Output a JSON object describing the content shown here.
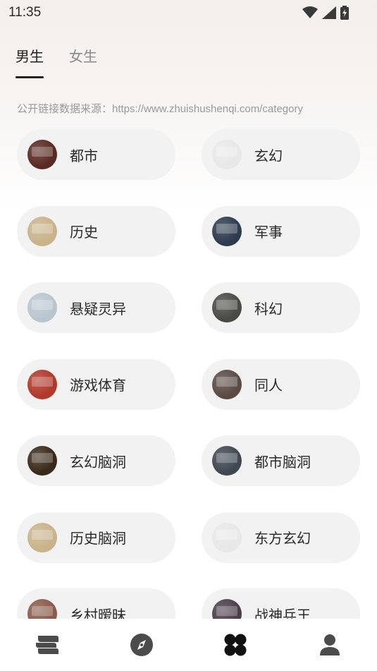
{
  "status_bar": {
    "time": "11:35"
  },
  "tabs": [
    {
      "label": "男生",
      "active": true
    },
    {
      "label": "女生",
      "active": false
    }
  ],
  "source_note": "公开链接数据来源：https://www.zhuishushenqi.com/category",
  "categories": [
    {
      "label": "都市",
      "thumb_color": "#5a2a22"
    },
    {
      "label": "玄幻",
      "thumb_color": "#e8e8e8"
    },
    {
      "label": "历史",
      "thumb_color": "#c9b38a"
    },
    {
      "label": "军事",
      "thumb_color": "#2e3a4e"
    },
    {
      "label": "悬疑灵异",
      "thumb_color": "#b9c6d0"
    },
    {
      "label": "科幻",
      "thumb_color": "#4a4a44"
    },
    {
      "label": "游戏体育",
      "thumb_color": "#b0392a"
    },
    {
      "label": "同人",
      "thumb_color": "#5b4a44"
    },
    {
      "label": "玄幻脑洞",
      "thumb_color": "#3a2a1a"
    },
    {
      "label": "都市脑洞",
      "thumb_color": "#3f4750"
    },
    {
      "label": "历史脑洞",
      "thumb_color": "#c9b38a"
    },
    {
      "label": "东方玄幻",
      "thumb_color": "#e8e8e8"
    },
    {
      "label": "乡村暧昧",
      "thumb_color": "#8a5a4a"
    },
    {
      "label": "战神兵王",
      "thumb_color": "#4a3e4a"
    }
  ],
  "bottom_nav": [
    {
      "icon": "bookshelf-icon",
      "active": false
    },
    {
      "icon": "compass-icon",
      "active": false
    },
    {
      "icon": "category-icon",
      "active": true
    },
    {
      "icon": "profile-icon",
      "active": false
    }
  ],
  "colors": {
    "nav_inactive": "#4b4b4b",
    "nav_active": "#111111",
    "pill_bg": "#f2f2f2"
  }
}
